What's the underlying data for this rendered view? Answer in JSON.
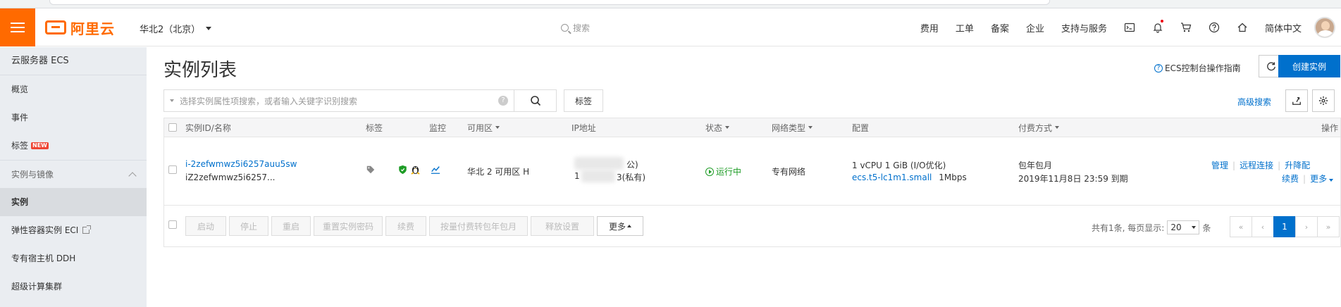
{
  "topbar": {
    "logo_text": "阿里云",
    "region": "华北2（北京）",
    "search_placeholder": "搜索",
    "links": [
      "费用",
      "工单",
      "备案",
      "企业",
      "支持与服务"
    ],
    "language": "简体中文"
  },
  "sidebar": {
    "title": "云服务器 ECS",
    "items_top": [
      "概览",
      "事件",
      "标签"
    ],
    "new_badge": "NEW",
    "section": "实例与镜像",
    "items": [
      "实例",
      "弹性容器实例 ECI",
      "专有宿主机 DDH",
      "超级计算集群"
    ]
  },
  "main": {
    "title": "实例列表",
    "guide_link": "ECS控制台操作指南",
    "create_button": "创建实例",
    "search_placeholder": "选择实例属性项搜索，或者输入关键字识别搜索",
    "tag_button": "标签",
    "advanced_search": "高级搜索"
  },
  "table": {
    "headers": {
      "id_name": "实例ID/名称",
      "tag": "标签",
      "monitor": "监控",
      "zone": "可用区",
      "ip": "IP地址",
      "status": "状态",
      "network": "网络类型",
      "config": "配置",
      "pay": "付费方式",
      "action": "操作"
    },
    "rows": [
      {
        "id": "i-2zefwmwz5i6257auu5sw",
        "name": "iZ2zefwmwz5i6257...",
        "zone": "华北 2 可用区 H",
        "ip_public_suffix": "公)",
        "ip_private_prefix": "1",
        "ip_private_suffix": "3(私有)",
        "status": "运行中",
        "network": "专有网络",
        "config_line1": "1 vCPU 1 GiB (I/O优化)",
        "config_type": "ecs.t5-lc1m1.small",
        "config_bandwidth": "1Mbps",
        "pay_type": "包年包月",
        "expire": "2019年11月8日 23:59 到期",
        "actions": {
          "manage": "管理",
          "remote": "远程连接",
          "upgrade": "升降配",
          "renew": "续费",
          "more": "更多"
        }
      }
    ]
  },
  "footer": {
    "batch_buttons": [
      "启动",
      "停止",
      "重启",
      "重置实例密码",
      "续费",
      "按量付费转包年包月",
      "释放设置"
    ],
    "more_button": "更多",
    "pager_prefix": "共有1条, 每页显示:",
    "page_size": "20",
    "pager_suffix": "条",
    "current_page": "1",
    "first": "«",
    "prev": "‹",
    "next": "›",
    "last": "»"
  },
  "colors": {
    "brand_orange": "#ff6a00",
    "link_blue": "#0070cc",
    "status_green": "#1e9c26",
    "sidebar_bg": "#eaedf1"
  }
}
